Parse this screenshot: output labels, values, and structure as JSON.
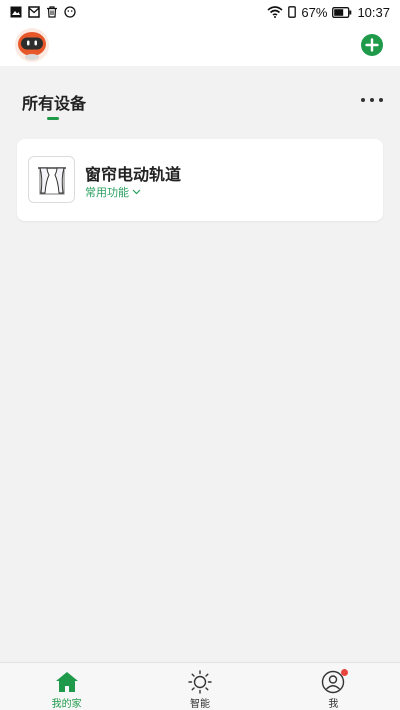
{
  "status_bar": {
    "battery": "67%",
    "time": "10:37",
    "left_icons": [
      "gallery-icon",
      "mail-icon",
      "trash-icon",
      "smile-icon"
    ],
    "right_icons": [
      "wifi-icon",
      "phone-icon",
      "battery-icon"
    ]
  },
  "header": {
    "avatar_icon": "robot-avatar-icon",
    "add_icon": "plus-circle-icon",
    "accent_color": "#1f9a4a"
  },
  "section": {
    "title": "所有设备",
    "more_icon": "more-dots-icon"
  },
  "devices": [
    {
      "name": "窗帘电动轨道",
      "function_label": "常用功能",
      "icon": "curtain-icon"
    }
  ],
  "bottom_nav": {
    "items": [
      {
        "label": "我的家",
        "icon": "home-icon",
        "active": true
      },
      {
        "label": "智能",
        "icon": "sun-icon",
        "active": false
      },
      {
        "label": "我",
        "icon": "user-icon",
        "active": false,
        "badge": true
      }
    ]
  }
}
